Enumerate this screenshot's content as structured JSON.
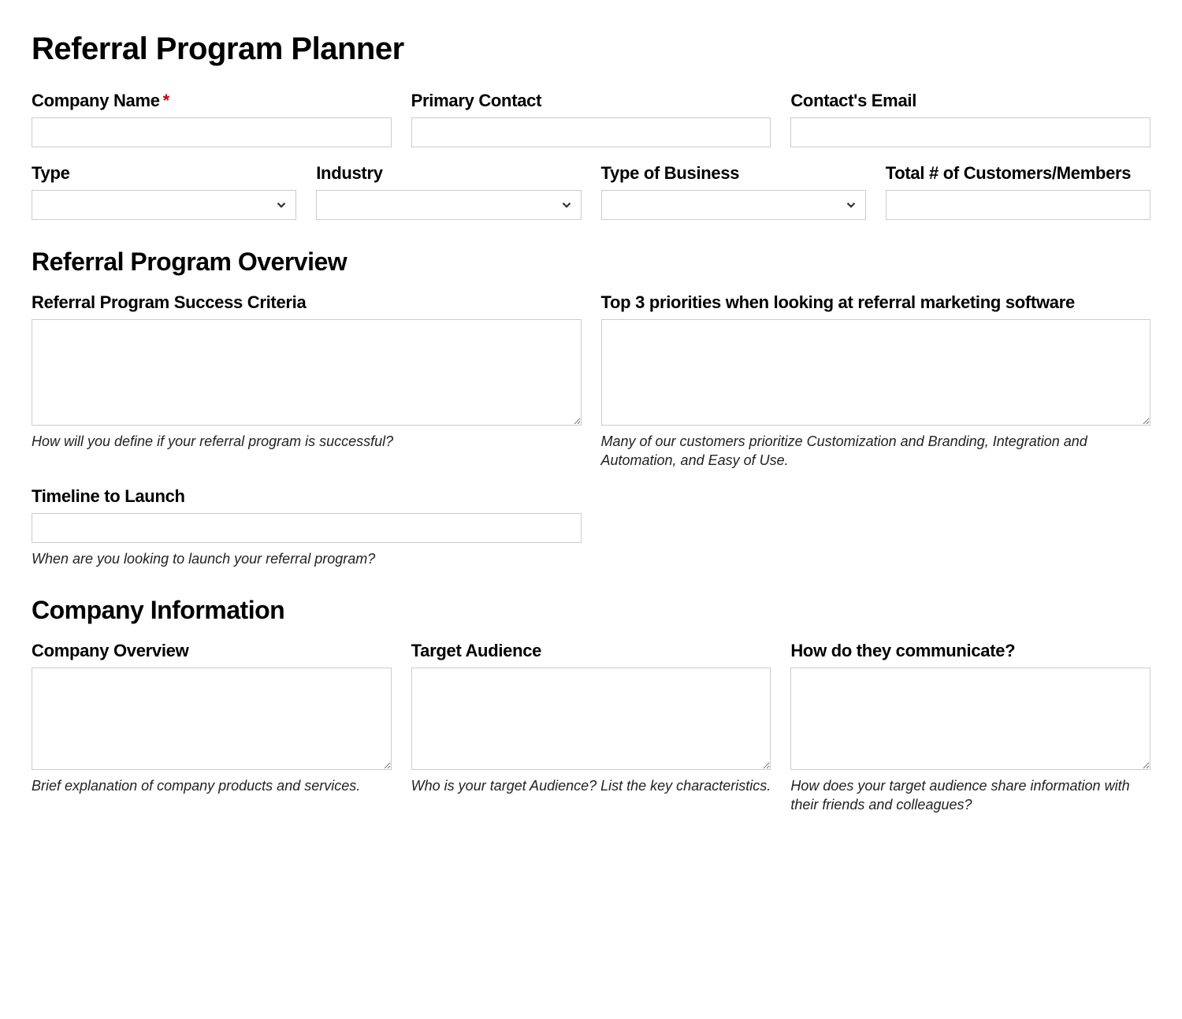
{
  "title": "Referral Program Planner",
  "row1": {
    "company_name": {
      "label": "Company Name",
      "required": "*",
      "value": ""
    },
    "primary_contact": {
      "label": "Primary Contact",
      "value": ""
    },
    "contact_email": {
      "label": "Contact's Email",
      "value": ""
    }
  },
  "row2": {
    "type": {
      "label": "Type",
      "value": ""
    },
    "industry": {
      "label": "Industry",
      "value": ""
    },
    "type_of_business": {
      "label": "Type of Business",
      "value": ""
    },
    "total_customers": {
      "label": "Total # of Customers/Members",
      "value": ""
    }
  },
  "overview": {
    "heading": "Referral Program Overview",
    "success_criteria": {
      "label": "Referral Program Success Criteria",
      "value": "",
      "hint": "How will you define if your referral program is successful?"
    },
    "top_priorities": {
      "label": "Top 3 priorities when looking at referral marketing software",
      "value": "",
      "hint": "Many of our customers prioritize Customization and Branding, Integration and Automation, and Easy of Use."
    },
    "timeline": {
      "label": "Timeline to Launch",
      "value": "",
      "hint": "When are you looking to launch your referral program?"
    }
  },
  "company_info": {
    "heading": "Company Information",
    "company_overview": {
      "label": "Company Overview",
      "value": "",
      "hint": "Brief explanation of company products and services."
    },
    "target_audience": {
      "label": "Target Audience",
      "value": "",
      "hint": "Who is your target Audience? List the key characteristics."
    },
    "communicate": {
      "label": "How do they communicate?",
      "value": "",
      "hint": "How does your target audience share information with their friends and colleagues?"
    }
  }
}
